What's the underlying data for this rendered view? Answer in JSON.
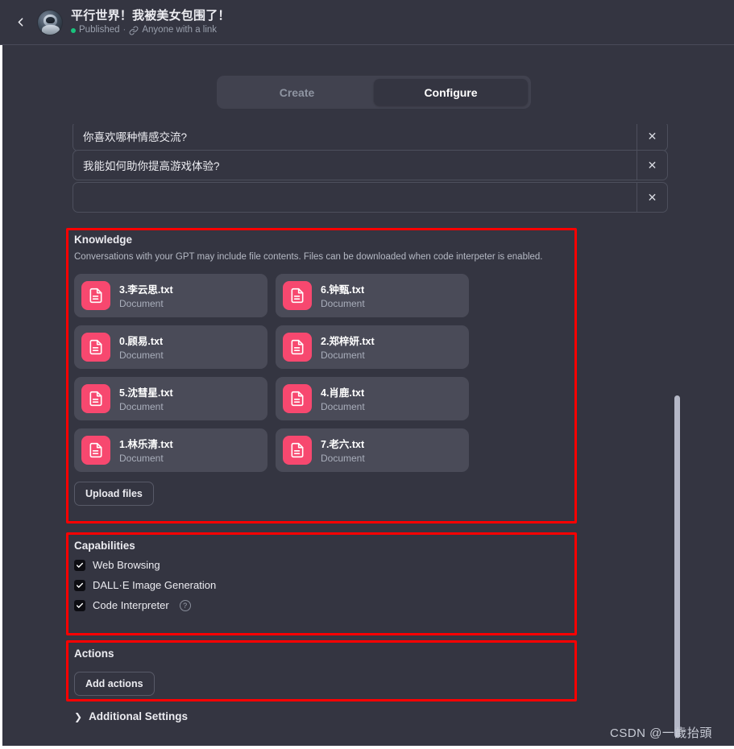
{
  "header": {
    "back_icon": "chevron-left-icon",
    "avatar_alt": "gpt-avatar",
    "title": "平行世界！我被美女包围了！",
    "status": "Published",
    "separator": "·",
    "link_icon": "link-icon",
    "visibility": "Anyone with a link"
  },
  "tabs": [
    {
      "label": "Create",
      "active": false
    },
    {
      "label": "Configure",
      "active": true
    }
  ],
  "conversation_starters": [
    {
      "value": "你喜欢哪种情感交流?",
      "remove_label": "✕"
    },
    {
      "value": "我能如何助你提高游戏体验?",
      "remove_label": "✕"
    },
    {
      "value": "",
      "remove_label": "✕"
    }
  ],
  "knowledge": {
    "title": "Knowledge",
    "description": "Conversations with your GPT may include file contents. Files can be downloaded when code interpeter is enabled.",
    "files": [
      {
        "name": "3.李云思.txt",
        "type": "Document"
      },
      {
        "name": "6.钟甄.txt",
        "type": "Document"
      },
      {
        "name": "0.顾易.txt",
        "type": "Document"
      },
      {
        "name": "2.郑梓妍.txt",
        "type": "Document"
      },
      {
        "name": "5.沈彗星.txt",
        "type": "Document"
      },
      {
        "name": "4.肖鹿.txt",
        "type": "Document"
      },
      {
        "name": "1.林乐清.txt",
        "type": "Document"
      },
      {
        "name": "7.老六.txt",
        "type": "Document"
      }
    ],
    "upload_button": "Upload files"
  },
  "capabilities": {
    "title": "Capabilities",
    "items": [
      {
        "label": "Web Browsing",
        "checked": true,
        "help": false
      },
      {
        "label": "DALL·E Image Generation",
        "checked": true,
        "help": false
      },
      {
        "label": "Code Interpreter",
        "checked": true,
        "help": true,
        "help_glyph": "?"
      }
    ]
  },
  "actions": {
    "title": "Actions",
    "add_button": "Add actions"
  },
  "additional_settings": {
    "chevron": "❯",
    "label": "Additional Settings"
  },
  "watermark": "CSDN @一歲抬頭",
  "colors": {
    "background": "#343541",
    "card": "#4a4b58",
    "file_icon": "#f7486f",
    "annotation": "#fe0000",
    "published_dot": "#19c37d",
    "scrollbar": "#b5b8c7"
  }
}
